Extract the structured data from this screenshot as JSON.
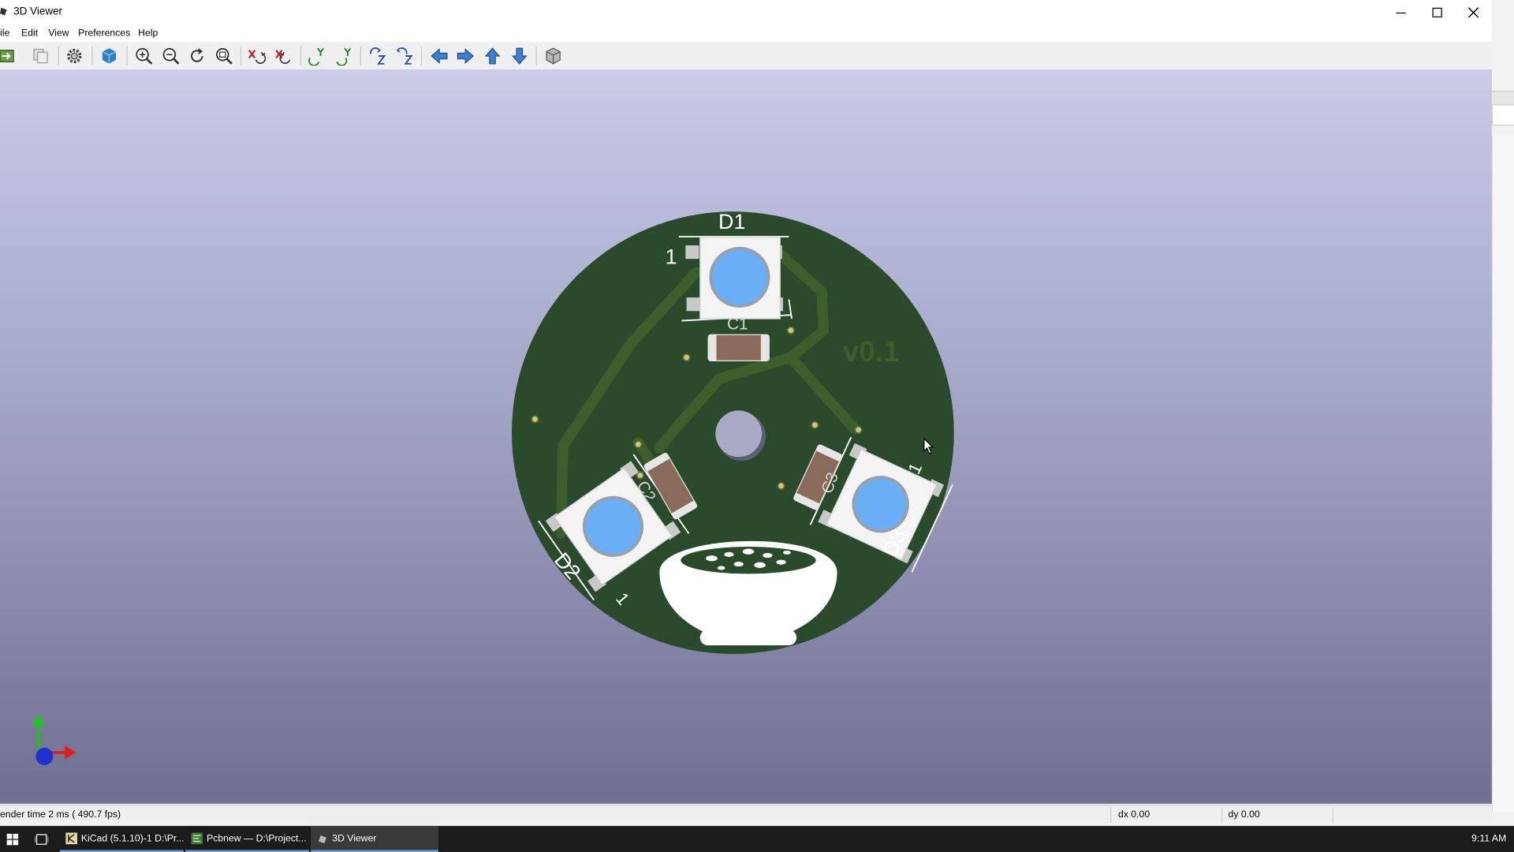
{
  "window": {
    "title": "3D Viewer",
    "controls": [
      "minimize",
      "maximize",
      "close"
    ]
  },
  "menu": {
    "items": [
      "ile",
      "Edit",
      "View",
      "Preferences",
      "Help"
    ]
  },
  "toolbar": {
    "icons": [
      "export-image-icon",
      "copy-icon",
      "settings-gear-icon",
      "render-mode-cube-icon",
      "zoom-in-icon",
      "zoom-out-icon",
      "redraw-icon",
      "zoom-fit-icon",
      "rotate-x-cw-icon",
      "rotate-x-ccw-icon",
      "rotate-y-cw-icon",
      "rotate-y-ccw-icon",
      "rotate-z-cw-icon",
      "rotate-z-ccw-icon",
      "move-left-icon",
      "move-right-icon",
      "move-up-icon",
      "move-down-icon",
      "orthographic-toggle-icon"
    ]
  },
  "board": {
    "silkscreen": {
      "d1": "D1",
      "d2": "D2",
      "d3": "D3",
      "pin1_d1": "1",
      "pin1_d2": "1",
      "pin1_d3": "1",
      "c1": "C1",
      "c2": "C2",
      "c3": "C3",
      "version": "v0.1"
    },
    "colors": {
      "soldermask": "#2a4a2c",
      "trace": "#3b5e2a",
      "led_lens": "#6aaef5",
      "silkscreen": "#ffffff",
      "capacitor_body": "#8a6a58",
      "background_top": "#c9cbe7",
      "background_bottom": "#6f6f8f"
    }
  },
  "axes_widget": {
    "x_color": "#e02020",
    "y_color": "#20c020",
    "z_color": "#2030d0"
  },
  "status": {
    "render_time": "ender time 2 ms ( 490.7 fps)",
    "dx": "dx 0.00",
    "dy": "dy 0.00"
  },
  "taskbar": {
    "items": [
      {
        "label": "KiCad (5.1.10)-1 D:\\Pr..."
      },
      {
        "label": "Pcbnew — D:\\Project..."
      },
      {
        "label": "3D Viewer"
      }
    ],
    "clock": "9:11 AM"
  }
}
